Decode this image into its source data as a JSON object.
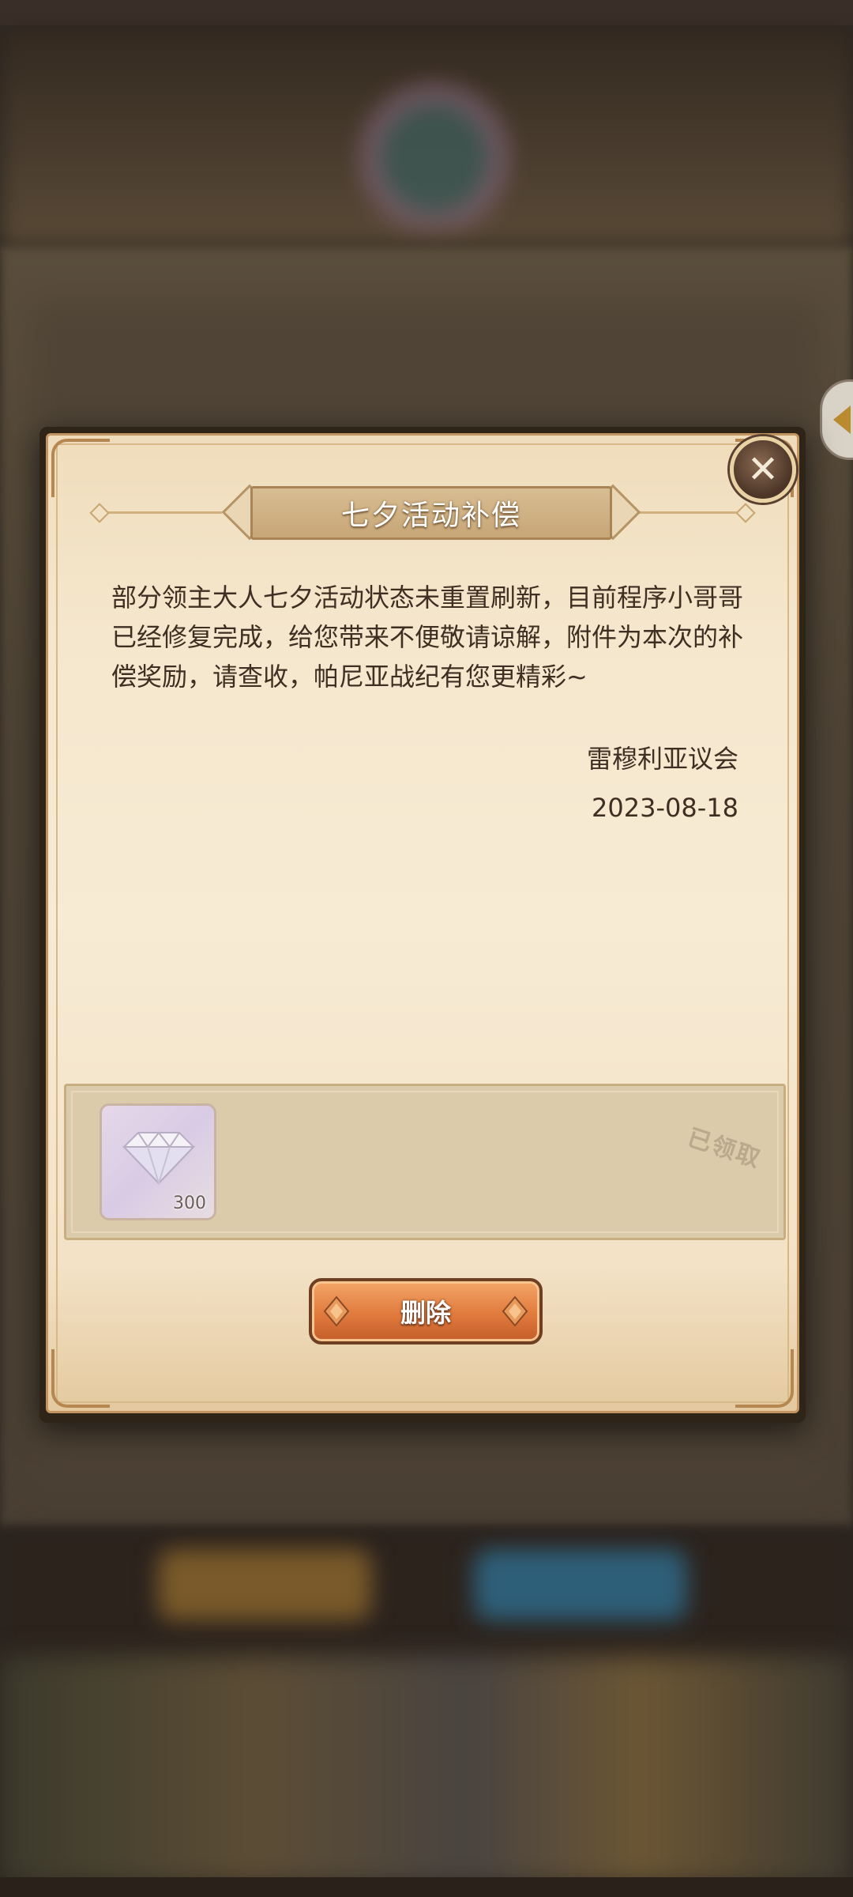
{
  "mail": {
    "title": "七夕活动补偿",
    "body": "部分领主大人七夕活动状态未重置刷新，目前程序小哥哥已经修复完成，给您带来不便敬请谅解，附件为本次的补偿奖励，请查收，帕尼亚战纪有您更精彩~",
    "sender": "雷穆利亚议会",
    "date": "2023-08-18"
  },
  "attachment": {
    "item_icon": "diamond-icon",
    "count": "300",
    "status": "已领取"
  },
  "actions": {
    "delete_label": "删除",
    "close_icon": "close-icon"
  },
  "colors": {
    "parchment": "#f5e7cd",
    "button_orange": "#e07a3d",
    "text_brown": "#3f2f22"
  }
}
